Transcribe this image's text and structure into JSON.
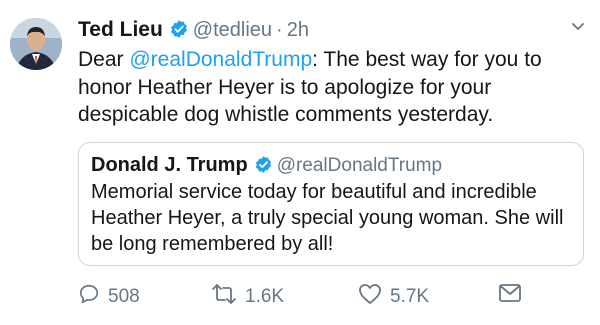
{
  "tweet": {
    "author_name": "Ted Lieu",
    "author_handle": "@tedlieu",
    "separator": "·",
    "time": "2h",
    "text_prefix": "Dear ",
    "mention": "@realDonaldTrump",
    "text_rest": ": The best way for you to honor Heather Heyer is to apologize for your despicable dog whistle comments yesterday."
  },
  "quoted_tweet": {
    "author_name": "Donald J. Trump",
    "author_handle": "@realDonaldTrump",
    "text": "Memorial service today for beautiful and incredible Heather Heyer, a truly special young woman. She will be long remembered by all!"
  },
  "actions": {
    "reply_count": "508",
    "retweet_count": "1.6K",
    "like_count": "5.7K"
  },
  "icons": {
    "verified": "verified-badge-icon",
    "reply": "reply-icon",
    "retweet": "retweet-icon",
    "like": "heart-icon",
    "message": "direct-message-icon",
    "menu": "chevron-down-icon"
  },
  "colors": {
    "accent": "#1da1f2",
    "secondary_text": "#657786",
    "border": "#ccd6dd"
  }
}
